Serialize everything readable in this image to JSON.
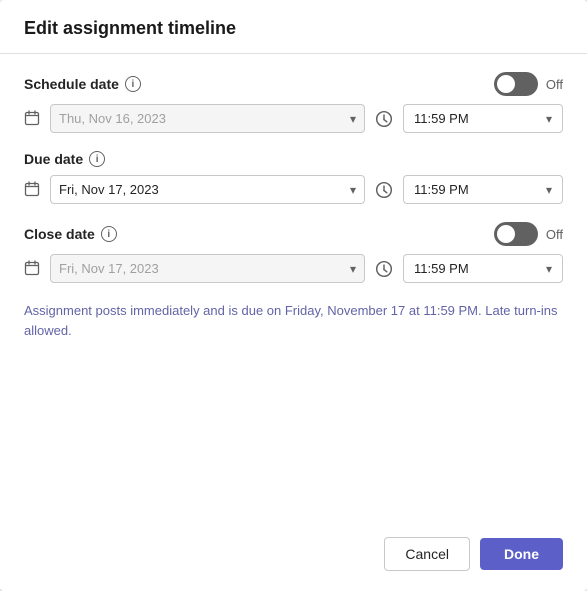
{
  "dialog": {
    "title": "Edit assignment timeline",
    "schedule_date": {
      "label": "Schedule date",
      "enabled": false,
      "toggle_label": "Off",
      "date_value": "Thu, Nov 16, 2023",
      "time_value": "11:59 PM"
    },
    "due_date": {
      "label": "Due date",
      "date_value": "Fri, Nov 17, 2023",
      "time_value": "11:59 PM"
    },
    "close_date": {
      "label": "Close date",
      "enabled": false,
      "toggle_label": "Off",
      "date_value": "Fri, Nov 17, 2023",
      "time_value": "11:59 PM"
    },
    "info_message": "Assignment posts immediately and is due on Friday, November 17 at 11:59 PM. Late turn-ins allowed.",
    "footer": {
      "cancel_label": "Cancel",
      "done_label": "Done"
    }
  }
}
